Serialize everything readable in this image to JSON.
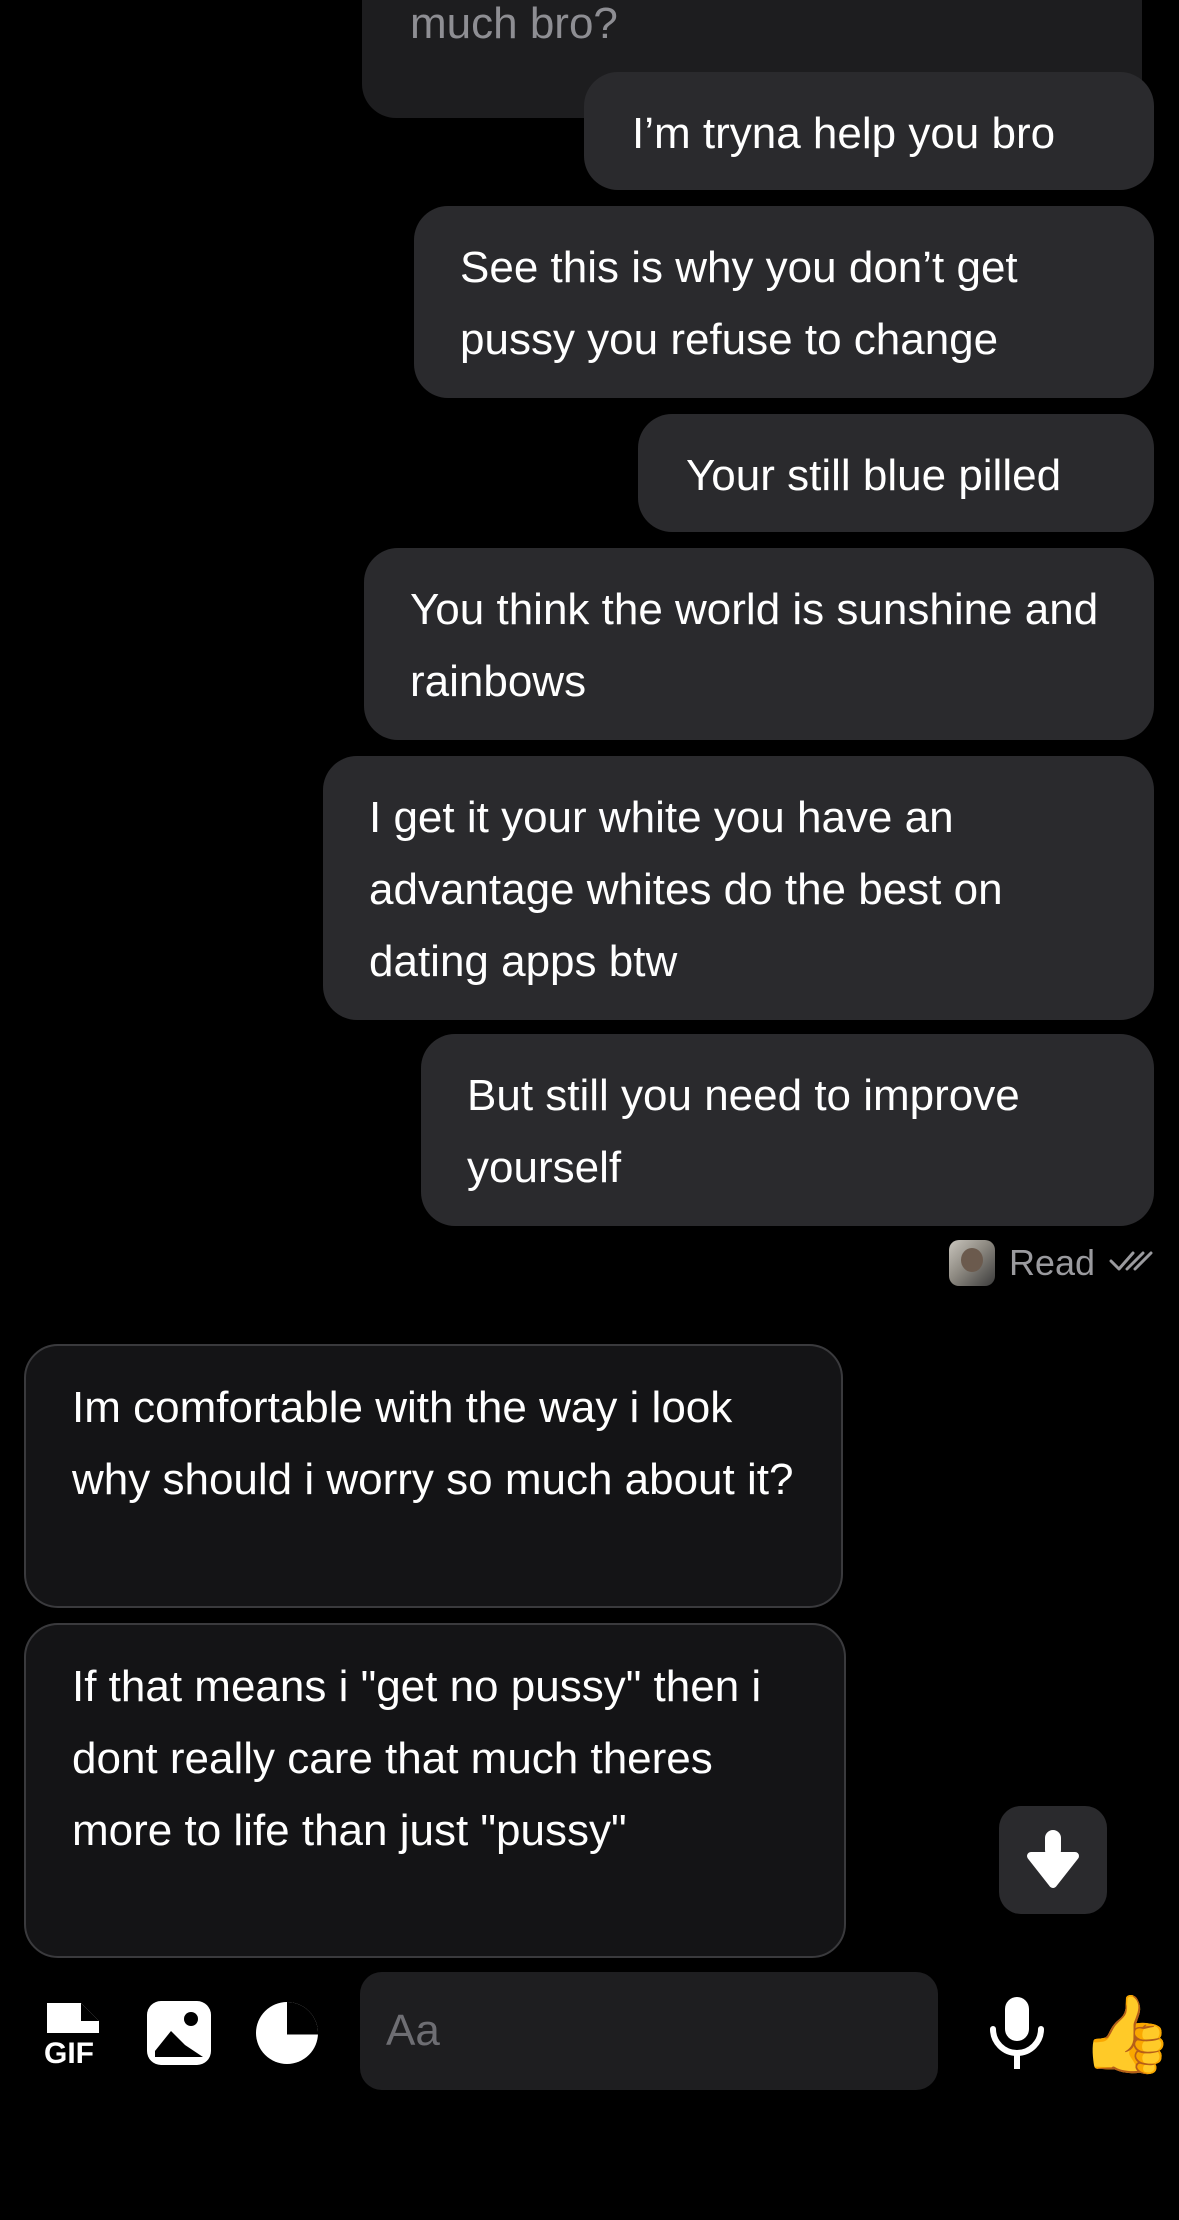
{
  "conversation": {
    "partial_top_text": "much bro?",
    "outgoing": [
      "I’m tryna help you bro",
      "See this is why you don’t get pussy you refuse to change",
      "Your still blue pilled",
      "You think the world is sunshine and rainbows",
      "I get it your white you have an advantage whites do the best on dating apps btw",
      "But still you need to improve yourself"
    ],
    "read_receipt": "Read",
    "incoming": [
      "Im comfortable with the way i look why should i worry so much about it?",
      "If that means i \"get no pussy\" then i dont really care that much theres more to life than just \"pussy\""
    ]
  },
  "composer": {
    "gif_label": "GIF",
    "placeholder": "Aa",
    "like_emoji": "👍"
  },
  "icons": {
    "gif": "gif-icon",
    "image": "image-icon",
    "sticker": "sticker-icon",
    "mic": "microphone-icon",
    "like": "thumbs-up-icon",
    "scroll": "arrow-down-icon",
    "read": "double-check-icon"
  },
  "colors": {
    "background": "#000000",
    "outgoing_bubble": "#2a2a2d",
    "incoming_bubble": "#141416",
    "secondary_text": "#9a9a9e"
  }
}
